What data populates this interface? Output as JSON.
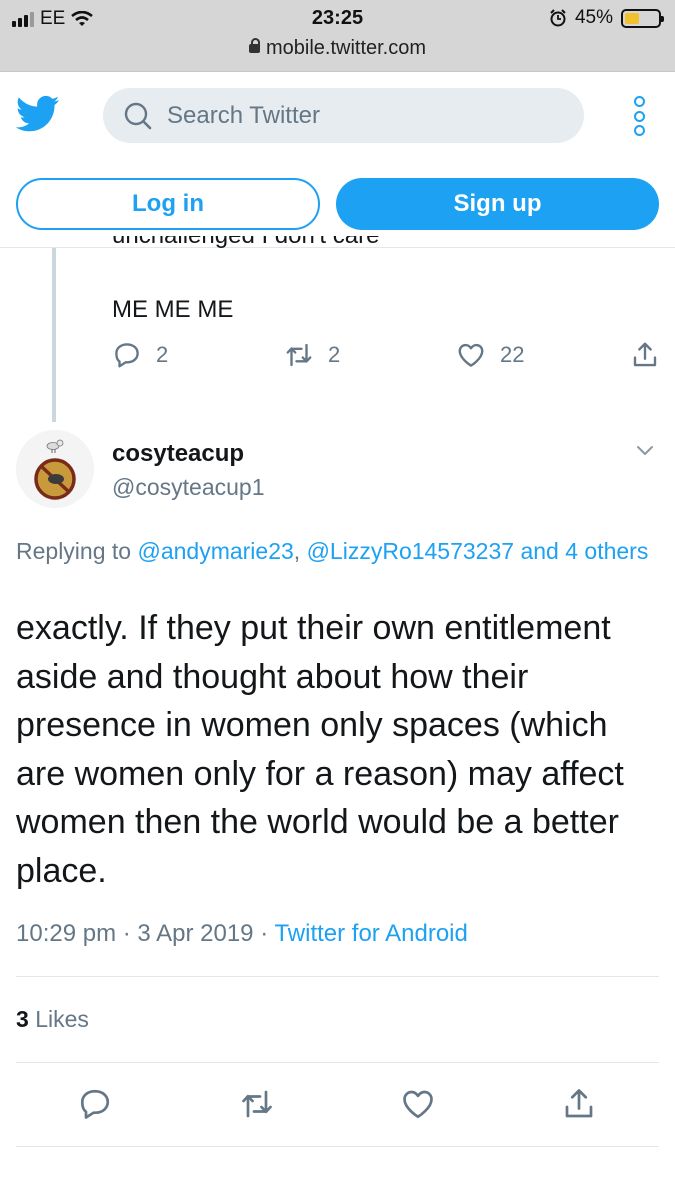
{
  "status_bar": {
    "carrier": "EE",
    "time": "23:25",
    "battery": "45%",
    "battery_level": 0.45,
    "url": "mobile.twitter.com"
  },
  "header": {
    "search_placeholder": "Search Twitter",
    "login_label": "Log in",
    "signup_label": "Sign up",
    "brand_color": "#1da1f2"
  },
  "previous_tweet": {
    "cut_text": "unchallenged I don't care",
    "text": "ME ME ME",
    "replies": "2",
    "retweets": "2",
    "likes": "22"
  },
  "tweet": {
    "display_name": "cosyteacup",
    "handle": "@cosyteacup1",
    "replying_prefix": "Replying to",
    "replying_user1": "@andymarie23",
    "replying_sep": ",",
    "replying_user2": "@LizzyRo14573237",
    "replying_others": "and 4 others",
    "text": "exactly. If they put their own entitlement aside and thought about how their presence in women only spaces (which are women only for a reason) may affect women then the world would be a better place.",
    "time": "10:29 pm",
    "date": "3 Apr 2019",
    "source": "Twitter for Android",
    "likes_count": "3",
    "likes_label": "Likes"
  },
  "icons": [
    "signal-icon",
    "wifi-icon",
    "alarm-icon",
    "battery-icon",
    "lock-icon",
    "twitter-bird-icon",
    "search-icon",
    "more-icon",
    "reply-icon",
    "retweet-icon",
    "like-icon",
    "share-icon",
    "chevron-down-icon"
  ]
}
